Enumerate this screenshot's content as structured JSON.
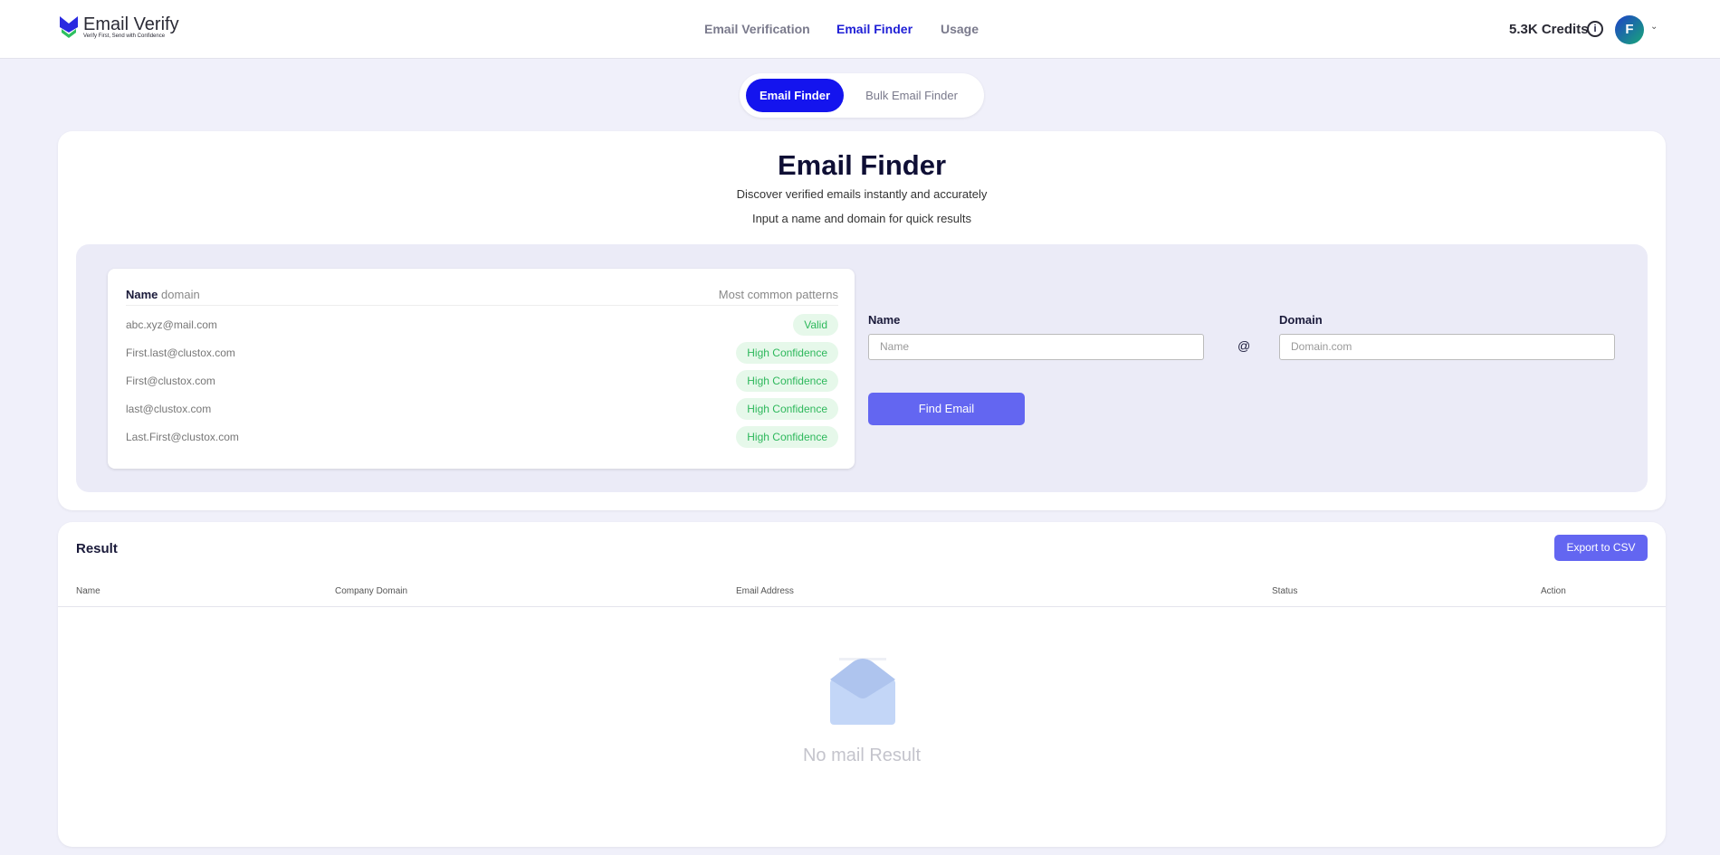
{
  "header": {
    "logo_title": "Email Verify",
    "logo_tagline": "Verify First, Send with Confidence",
    "nav": [
      "Email Verification",
      "Email Finder",
      "Usage"
    ],
    "active_nav": "Email Finder",
    "credits": "5.3K Credits",
    "avatar_initial": "F"
  },
  "toggle": {
    "active": "Email Finder",
    "other": "Bulk Email Finder"
  },
  "finder": {
    "title": "Email Finder",
    "subtitle1": "Discover verified emails instantly and accurately",
    "subtitle2": "Input a name and domain for quick results",
    "patterns": {
      "header_name": "Name",
      "header_domain": "domain",
      "header_right": "Most common patterns",
      "rows": [
        {
          "email": "abc.xyz@mail.com",
          "badge": "Valid"
        },
        {
          "email": "First.last@clustox.com",
          "badge": "High Confidence"
        },
        {
          "email": "First@clustox.com",
          "badge": "High Confidence"
        },
        {
          "email": "last@clustox.com",
          "badge": "High Confidence"
        },
        {
          "email": "Last.First@clustox.com",
          "badge": "High Confidence"
        }
      ]
    },
    "name_label": "Name",
    "name_placeholder": "Name",
    "at": "@",
    "domain_label": "Domain",
    "domain_placeholder": "Domain.com",
    "find_button": "Find Email"
  },
  "result": {
    "title": "Result",
    "export_button": "Export to CSV",
    "columns": [
      "Name",
      "Company Domain",
      "Email Address",
      "Status",
      "Action"
    ],
    "empty_text": "No mail Result"
  },
  "colors": {
    "primary": "#1414ee",
    "button": "#6366f1",
    "badge_green": "#2eb85c"
  }
}
